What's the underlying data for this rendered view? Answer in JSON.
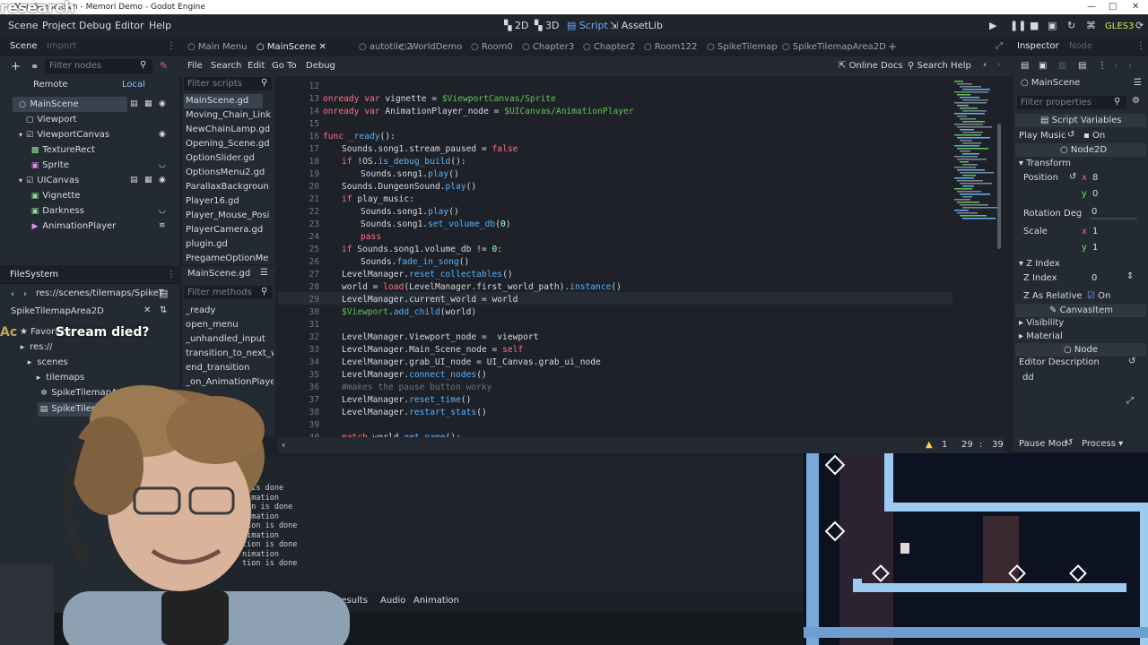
{
  "window": {
    "title": "MainScene.tscn - Memori Demo - Godot Engine",
    "overlay_title": "research"
  },
  "menubar": {
    "items": [
      "Scene",
      "Project",
      "Debug",
      "Editor",
      "Help"
    ],
    "workspaces": [
      "2D",
      "3D",
      "Script",
      "AssetLib"
    ],
    "renderer": "GLES3"
  },
  "scene_dock": {
    "tabs": [
      "Scene",
      "Import"
    ],
    "filter_placeholder": "Filter nodes",
    "remote": "Remote",
    "local": "Local",
    "nodes": [
      {
        "label": "MainScene",
        "icon": "circle-icon"
      },
      {
        "label": "Viewport",
        "icon": "control-icon"
      },
      {
        "label": "ViewportCanvas",
        "icon": "checkbox-icon"
      },
      {
        "label": "TextureRect",
        "icon": "texture-icon"
      },
      {
        "label": "Sprite",
        "icon": "sprite-icon"
      },
      {
        "label": "UICanvas",
        "icon": "checkbox-icon"
      },
      {
        "label": "Vignette",
        "icon": "control-icon"
      },
      {
        "label": "Darkness",
        "icon": "control-icon"
      },
      {
        "label": "AnimationPlayer",
        "icon": "animation-icon"
      }
    ]
  },
  "filesystem_dock": {
    "title": "FileSystem",
    "path": "res://scenes/tilemaps/SpikeT",
    "search_value": "SpikeTilemapArea2D",
    "favorites": "Favorites:",
    "tree": [
      "res://",
      "scenes",
      "tilemaps",
      "SpikeTilemapArea2D",
      "SpikeTilemapAr"
    ]
  },
  "chat_overlay": {
    "prefix": "Ac",
    "message": "Stream died?"
  },
  "editor_tabs": [
    "Main Menu",
    "MainScene",
    "autotile 2",
    "WorldDemo",
    "Room0",
    "Chapter3",
    "Chapter2",
    "Room122",
    "SpikeTilemap",
    "SpikeTilemapArea2D"
  ],
  "script_menu": {
    "items": [
      "File",
      "Search",
      "Edit",
      "Go To",
      "Debug"
    ],
    "online_docs": "Online Docs",
    "search_help": "Search Help"
  },
  "script_list": {
    "filter_placeholder": "Filter scripts",
    "scripts": [
      "MainScene.gd",
      "Moving_Chain_Link",
      "NewChainLamp.gd",
      "Opening_Scene.gd",
      "OptionSlider.gd",
      "OptionsMenu2.gd",
      "ParallaxBackgroun",
      "Player16.gd",
      "Player_Mouse_Posi",
      "PlayerCamera.gd",
      "plugin.gd",
      "PregameOptionMe"
    ],
    "current_file": "MainScene.gd",
    "methods_placeholder": "Filter methods",
    "methods": [
      "_ready",
      "open_menu",
      "_unhandled_input",
      "transition_to_next_wor",
      "end_transition",
      "_on_AnimationPlayer_"
    ]
  },
  "code": {
    "lines": [
      {
        "n": "12",
        "indent": 0,
        "text": ""
      },
      {
        "n": "13",
        "indent": 0,
        "text": "onready var vignette = $ViewportCanvas/Sprite"
      },
      {
        "n": "14",
        "indent": 0,
        "text": "onready var AnimationPlayer_node = $UICanvas/AnimationPlayer"
      },
      {
        "n": "15",
        "indent": 0,
        "text": ""
      },
      {
        "n": "16",
        "indent": 0,
        "text": "func _ready():"
      },
      {
        "n": "17",
        "indent": 1,
        "text": "Sounds.song1.stream_paused = false"
      },
      {
        "n": "18",
        "indent": 1,
        "text": "if !OS.is_debug_build():"
      },
      {
        "n": "19",
        "indent": 2,
        "text": "Sounds.song1.play()"
      },
      {
        "n": "20",
        "indent": 1,
        "text": "Sounds.DungeonSound.play()"
      },
      {
        "n": "21",
        "indent": 1,
        "text": "if play_music:"
      },
      {
        "n": "22",
        "indent": 2,
        "text": "Sounds.song1.play()"
      },
      {
        "n": "23",
        "indent": 2,
        "text": "Sounds.song1.set_volume_db(0)"
      },
      {
        "n": "24",
        "indent": 2,
        "text": "pass"
      },
      {
        "n": "25",
        "indent": 1,
        "text": "if Sounds.song1.volume_db != 0:"
      },
      {
        "n": "26",
        "indent": 2,
        "text": "Sounds.fade_in_song()"
      },
      {
        "n": "27",
        "indent": 1,
        "text": "LevelManager.reset_collectables()"
      },
      {
        "n": "28",
        "indent": 1,
        "text": "world = load(LevelManager.first_world_path).instance()"
      },
      {
        "n": "29",
        "indent": 1,
        "text": "LevelManager.current_world = world"
      },
      {
        "n": "30",
        "indent": 1,
        "text": "$Viewport.add_child(world)"
      },
      {
        "n": "31",
        "indent": 0,
        "text": ""
      },
      {
        "n": "32",
        "indent": 1,
        "text": "LevelManager.Viewport_node =  viewport"
      },
      {
        "n": "33",
        "indent": 1,
        "text": "LevelManager.Main_Scene_node = self"
      },
      {
        "n": "34",
        "indent": 1,
        "text": "LevelManager.grab_UI_node = UI_Canvas.grab_ui_node"
      },
      {
        "n": "35",
        "indent": 1,
        "text": "LevelManager.connect_nodes()"
      },
      {
        "n": "36",
        "indent": 1,
        "text": "#makes the pause button worky"
      },
      {
        "n": "37",
        "indent": 1,
        "text": "LevelManager.reset_time()"
      },
      {
        "n": "38",
        "indent": 1,
        "text": "LevelManager.restart_stats()"
      },
      {
        "n": "39",
        "indent": 0,
        "text": ""
      },
      {
        "n": "40",
        "indent": 1,
        "text": "match world.get_name():"
      }
    ],
    "warning_count": "1",
    "cursor_line": "29",
    "cursor_col": "39"
  },
  "output_panel": {
    "lines": [
      "n is done",
      "nimation",
      "ton is done",
      "nimation",
      "tion is done",
      "nimation",
      "tion is done",
      "nimation",
      "tion is done"
    ],
    "tabs": [
      "rch Results",
      "Audio",
      "Animation"
    ]
  },
  "inspector": {
    "tabs": [
      "Inspector",
      "Node"
    ],
    "object": "MainScene",
    "filter_placeholder": "Filter properties",
    "script_variables": "Script Variables",
    "play_music_label": "Play Music",
    "play_music_value": "On",
    "node2d": "Node2D",
    "transform": "Transform",
    "position_label": "Position",
    "position_x": "8",
    "position_y": "0",
    "rotation_label": "Rotation Deg",
    "rotation_value": "0",
    "scale_label": "Scale",
    "scale_x": "1",
    "scale_y": "1",
    "z_index_section": "Z Index",
    "z_index_label": "Z Index",
    "z_index_value": "0",
    "z_relative_label": "Z As Relative",
    "z_relative_value": "On",
    "canvasitem": "CanvasItem",
    "visibility": "Visibility",
    "material": "Material",
    "node": "Node",
    "editor_description_label": "Editor Description",
    "editor_description_value": "dd",
    "pause_mode_label": "Pause Mod",
    "pause_mode_value": "Process"
  },
  "colors": {
    "accent": "#6fa8ff",
    "bg": "#1d2229",
    "panel": "#242a31"
  }
}
